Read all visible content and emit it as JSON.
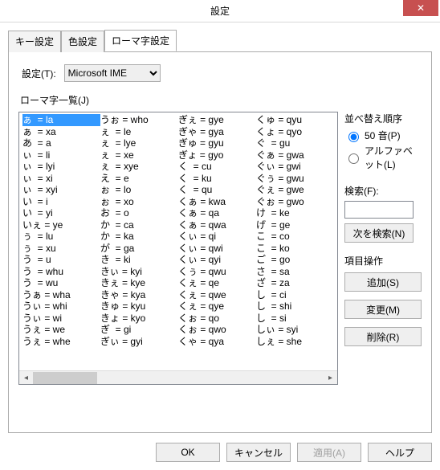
{
  "window": {
    "title": "設定"
  },
  "tabs": {
    "key": "キー設定",
    "color": "色設定",
    "romaji": "ローマ字設定"
  },
  "setting": {
    "label": "設定(T):",
    "value": "Microsoft IME"
  },
  "list": {
    "label": "ローマ字一覧(J)",
    "col1": [
      "ぁ  = la",
      "ぁ  = xa",
      "あ  = a",
      "ぃ  = li",
      "ぃ  = lyi",
      "ぃ  = xi",
      "ぃ  = xyi",
      "い  = i",
      "い  = yi",
      "いぇ = ye",
      "ぅ  = lu",
      "ぅ  = xu",
      "う  = u",
      "う  = whu",
      "う  = wu",
      "うぁ = wha",
      "うぃ = whi",
      "うぃ = wi",
      "うぇ = we",
      "うぇ = whe"
    ],
    "col2": [
      "うぉ = who",
      "ぇ  = le",
      "ぇ  = lye",
      "ぇ  = xe",
      "ぇ  = xye",
      "え  = e",
      "ぉ  = lo",
      "ぉ  = xo",
      "お  = o",
      "か  = ca",
      "か  = ka",
      "が  = ga",
      "き  = ki",
      "きぃ = kyi",
      "きぇ = kye",
      "きゃ = kya",
      "きゅ = kyu",
      "きょ = kyo",
      "ぎ  = gi",
      "ぎぃ = gyi"
    ],
    "col3": [
      "ぎぇ = gye",
      "ぎゃ = gya",
      "ぎゅ = gyu",
      "ぎょ = gyo",
      "く  = cu",
      "く  = ku",
      "く  = qu",
      "くぁ = kwa",
      "くぁ = qa",
      "くぁ = qwa",
      "くぃ = qi",
      "くぃ = qwi",
      "くぃ = qyi",
      "くぅ = qwu",
      "くぇ = qe",
      "くぇ = qwe",
      "くぇ = qye",
      "くぉ = qo",
      "くぉ = qwo",
      "くゃ = qya"
    ],
    "col4": [
      "くゅ = qyu",
      "くょ = qyo",
      "ぐ  = gu",
      "ぐぁ = gwa",
      "ぐぃ = gwi",
      "ぐぅ = gwu",
      "ぐぇ = gwe",
      "ぐぉ = gwo",
      "け  = ke",
      "げ  = ge",
      "こ  = co",
      "こ  = ko",
      "ご  = go",
      "さ  = sa",
      "ざ  = za",
      "し  = ci",
      "し  = shi",
      "し  = si",
      "しぃ = syi",
      "しぇ = she"
    ]
  },
  "sort": {
    "title": "並べ替え順序",
    "opt50": "50 音(P)",
    "optAlpha": "アルファベット(L)",
    "selected": "50"
  },
  "search": {
    "label": "検索(F):",
    "value": "",
    "nextBtn": "次を検索(N)"
  },
  "ops": {
    "title": "項目操作",
    "add": "追加(S)",
    "change": "変更(M)",
    "delete": "削除(R)"
  },
  "buttons": {
    "ok": "OK",
    "cancel": "キャンセル",
    "apply": "適用(A)",
    "help": "ヘルプ"
  }
}
